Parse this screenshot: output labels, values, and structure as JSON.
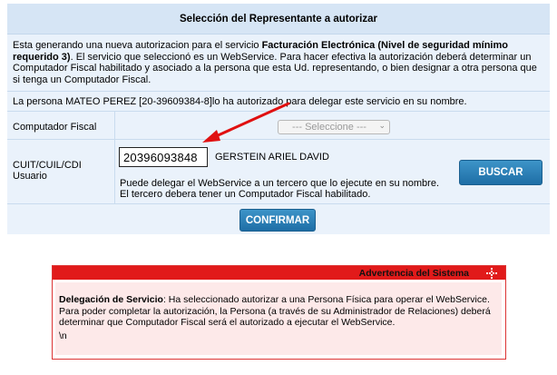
{
  "panel": {
    "title": "Selección del Representante a autorizar",
    "intro_1": "Esta generando una nueva autorizacion para el servicio ",
    "intro_service": "Facturación Electrónica (Nivel de seguridad mínimo requerido 3)",
    "intro_2": ". El servicio que seleccionó es un WebService. Para hacer efectiva la autorización deberá determinar un Computador Fiscal habilitado y asociado a la persona que esta Ud. representando, o bien designar a otra persona que si tenga un Computador Fiscal.",
    "delegation_msg": "La persona MATEO PEREZ [20-39609384-8]lo ha autorizado para delegar este servicio en su nombre.",
    "computador_label": "Computador Fiscal",
    "computador_select": "--- Seleccione ---",
    "cuit_label_1": "CUIT/CUIL/CDI",
    "cuit_label_2": "Usuario",
    "cuit_value": "20396093848",
    "cuit_name": "GERSTEIN ARIEL DAVID",
    "help_1": "Puede delegar el WebService a un tercero que lo ejecute en su nombre.",
    "help_2": "El tercero debera tener un Computador Fiscal habilitado.",
    "buscar_label": "BUSCAR",
    "confirmar_label": "CONFIRMAR"
  },
  "warning": {
    "header": "Advertencia del Sistema",
    "bold_prefix": "Delegación de Servicio",
    "text": ": Ha seleccionado autorizar a una Persona Física para operar el WebService. Para poder completar la autorización, la Persona (a través de su Administrador de Relaciones) deberá determinar que Computador Fiscal será el autorizado a ejecutar el WebService.",
    "trailer": "\\n"
  },
  "colors": {
    "panel_bg": "#eaf2fb",
    "button_blue": "#1e6ea6",
    "warning_red": "#e11a1a",
    "arrow_red": "#e01010"
  },
  "icons": {
    "select_arrow": "chevron-down-icon",
    "warning_icon": "red-dotted-cross-icon"
  }
}
